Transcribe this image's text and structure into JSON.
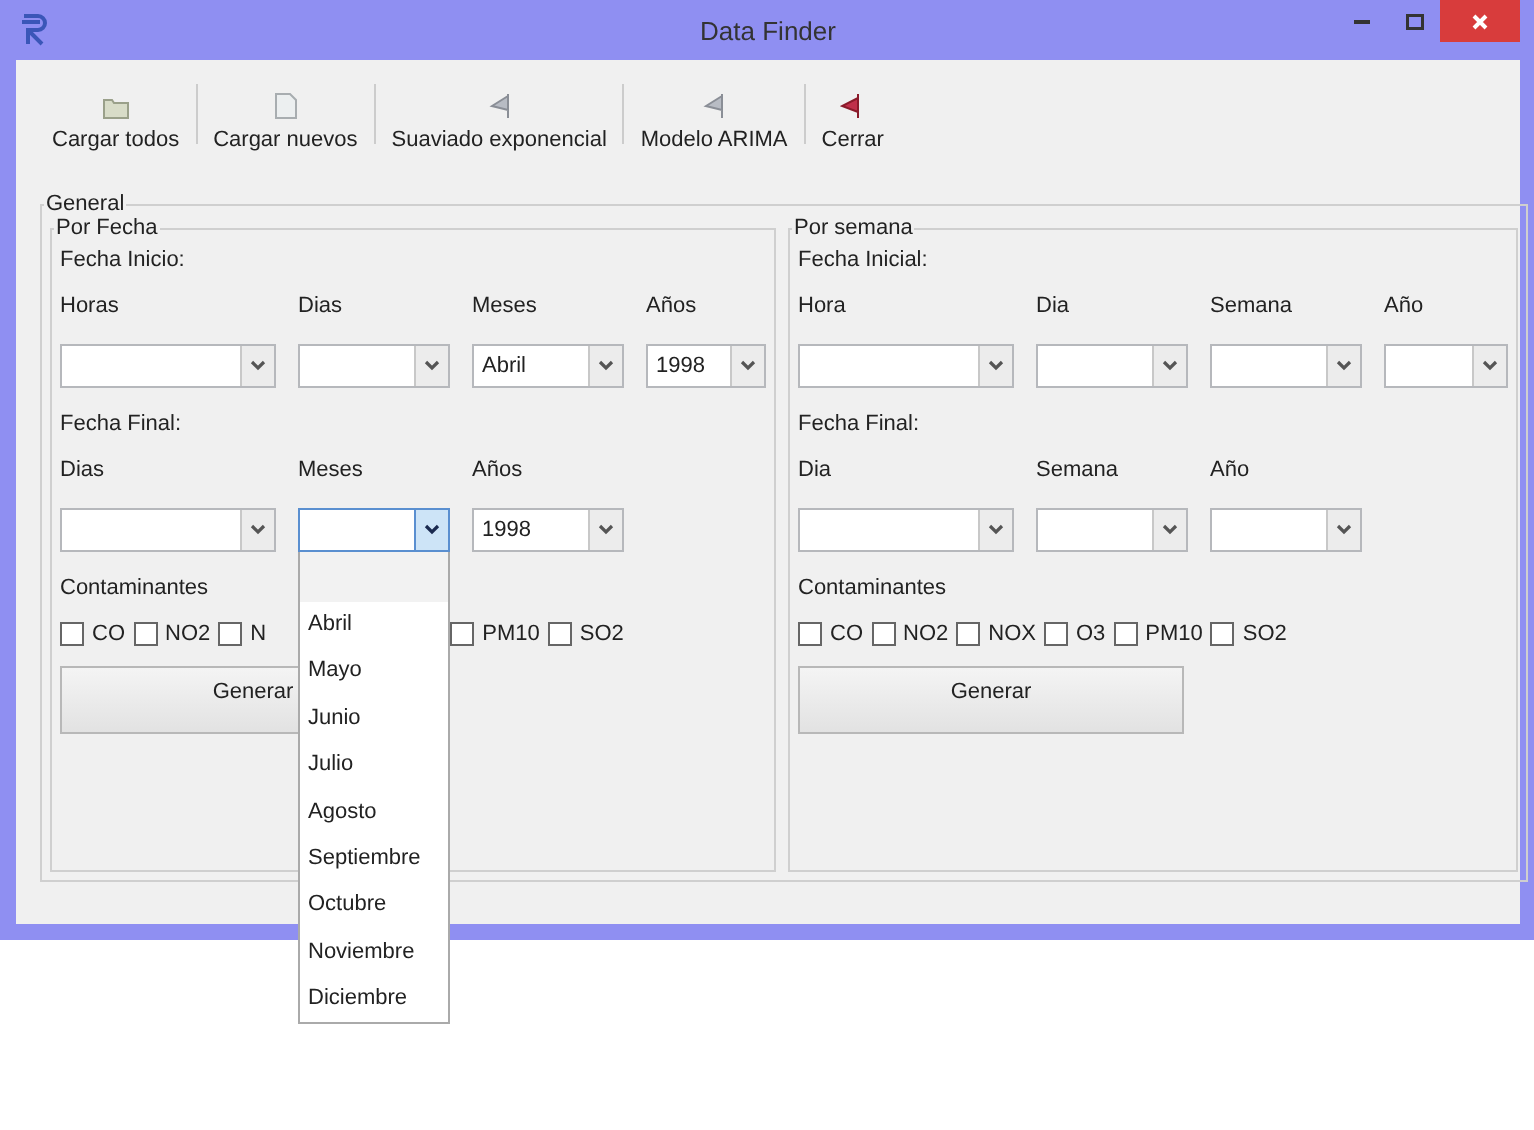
{
  "window": {
    "title": "Data Finder"
  },
  "toolbar": [
    {
      "label": "Cargar todos",
      "kind": "folder"
    },
    {
      "label": "Cargar nuevos",
      "kind": "page"
    },
    {
      "label": "Suaviado exponencial",
      "kind": "flag"
    },
    {
      "label": "Modelo ARIMA",
      "kind": "flag"
    },
    {
      "label": "Cerrar",
      "kind": "exit"
    }
  ],
  "general": {
    "title": "General",
    "sections": [
      {
        "title": "Por Fecha",
        "start": {
          "label": "Fecha Inicio:",
          "fields": [
            {
              "label": "Horas",
              "focused": false
            },
            {
              "label": "Dias",
              "focused": false
            },
            {
              "label": "Meses",
              "value": "Abril",
              "focused": false
            },
            {
              "label": "Años",
              "value": "1998",
              "focused": false
            }
          ]
        },
        "end": {
          "label": "Fecha Final:",
          "fields": [
            {
              "label": "Dias",
              "focused": false
            },
            {
              "label": "Meses",
              "focused": true
            },
            {
              "label": "Años",
              "value": "1998",
              "focused": false
            }
          ]
        },
        "pollutants_label": "Contaminantes",
        "pollutants": [
          {
            "label": "CO",
            "checked": false,
            "kind": "full"
          },
          {
            "label": "NO2",
            "checked": false,
            "kind": "full"
          },
          {
            "label": "N",
            "checked": false,
            "kind": "covered"
          },
          {
            "label": "PM10",
            "checked": false,
            "kind": "full"
          },
          {
            "label": "SO2",
            "checked": false,
            "kind": "full"
          }
        ],
        "button": "Generar"
      },
      {
        "title": "Por semana",
        "start": {
          "label": "Fecha Inicial:",
          "fields": [
            {
              "label": "Hora",
              "focused": false
            },
            {
              "label": "Dia",
              "focused": false
            },
            {
              "label": "Semana",
              "focused": false
            },
            {
              "label": "Año",
              "focused": false
            }
          ]
        },
        "end": {
          "label": "Fecha Final:",
          "fields": [
            {
              "label": "Dia",
              "focused": false
            },
            {
              "label": "Semana",
              "focused": false
            },
            {
              "label": "Año",
              "focused": false
            }
          ]
        },
        "pollutants_label": "Contaminantes",
        "pollutants": [
          {
            "label": "CO",
            "checked": false,
            "kind": "full"
          },
          {
            "label": "NO2",
            "checked": false,
            "kind": "full"
          },
          {
            "label": "NOX",
            "checked": false,
            "kind": "full"
          },
          {
            "label": "O3",
            "checked": false,
            "kind": "full"
          },
          {
            "label": "PM10",
            "checked": false,
            "kind": "full"
          },
          {
            "label": "SO2",
            "checked": false,
            "kind": "full"
          }
        ],
        "button": "Generar"
      }
    ]
  },
  "dropdown": {
    "items": [
      {
        "label": "Abril"
      },
      {
        "label": "Mayo"
      },
      {
        "label": "Junio"
      },
      {
        "label": "Julio"
      },
      {
        "label": "Agosto"
      },
      {
        "label": "Septiembre"
      },
      {
        "label": "Octubre"
      },
      {
        "label": "Noviembre"
      },
      {
        "label": "Diciembre"
      }
    ]
  }
}
